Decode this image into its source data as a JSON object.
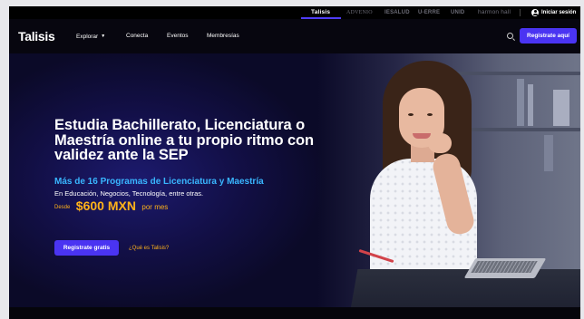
{
  "brand_bar": {
    "brands": [
      "Talisis",
      "ADVENIO",
      "IESALUD",
      "U-ERRE",
      "UNID",
      "harmon hall"
    ],
    "active_brand": "Talisis",
    "login_label": "Iniciar sesión"
  },
  "nav": {
    "logo": "Talisis",
    "items": [
      {
        "label": "Explorar",
        "has_dropdown": true
      },
      {
        "label": "Conecta"
      },
      {
        "label": "Eventos"
      },
      {
        "label": "Membresías"
      }
    ],
    "cta_label": "Registrate aquí"
  },
  "hero": {
    "headline": "Estudia Bachillerato, Licenciatura o Maestría online a tu propio ritmo con validez ante la SEP",
    "subheadline": "Más de 16 Programas de Licenciatura y Maestría",
    "description": "En Educación, Negocios, Tecnología, entre otras.",
    "price_prefix": "Desde",
    "price": "$600 MXN",
    "price_suffix": "por mes",
    "cta_label": "Registrate gratis",
    "secondary_link": "¿Qué es Talisis?"
  },
  "colors": {
    "accent": "#4a34f2",
    "highlight_blue": "#39b6ff",
    "price_orange": "#ffb21a",
    "nav_bg": "#07060f"
  },
  "icons": [
    "user-circle-icon",
    "chevron-down-icon",
    "search-icon"
  ]
}
